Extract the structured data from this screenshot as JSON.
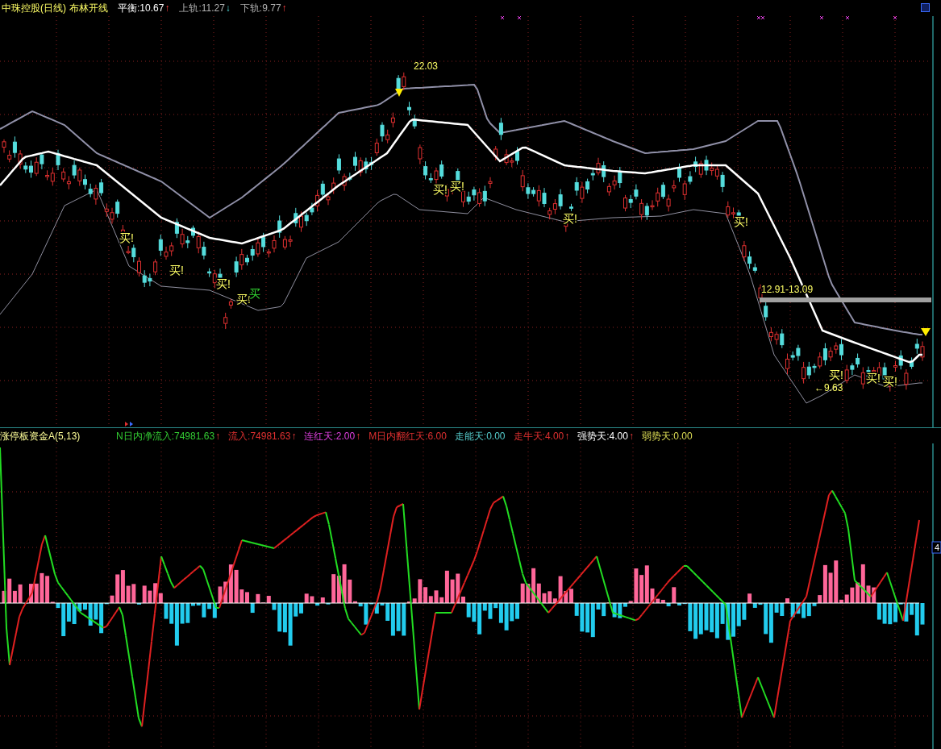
{
  "price_panel": {
    "title": "中珠控股(日线)",
    "indicator_name": "布林开线",
    "readings": [
      {
        "label": "平衡:10.67",
        "color": "#ffffff",
        "arrow": "↑"
      },
      {
        "label": "上轨:11.27",
        "color": "#b0b0b0",
        "arrow": "↓"
      },
      {
        "label": "下轨:9.77",
        "color": "#b0b0b0",
        "arrow": "↑"
      }
    ],
    "peak_label": "22.03",
    "range_label": "12.91-13.09",
    "low_label": "←9.63",
    "signals": [
      {
        "text": "买!",
        "kind": "buy"
      },
      {
        "text": "买!",
        "kind": "buy"
      },
      {
        "text": "买!",
        "kind": "buy"
      },
      {
        "text": "买!",
        "kind": "buy"
      },
      {
        "text": "买",
        "kind": "strong"
      },
      {
        "text": "买!",
        "kind": "buy"
      },
      {
        "text": "买!",
        "kind": "buy"
      },
      {
        "text": "买!",
        "kind": "buy"
      },
      {
        "text": "买!",
        "kind": "buy"
      },
      {
        "text": "买!",
        "kind": "buy"
      },
      {
        "text": "买!",
        "kind": "buy"
      },
      {
        "text": "买!",
        "kind": "buy"
      }
    ]
  },
  "indicator_panel": {
    "title": "涨停板资金A(5,13)",
    "readings": [
      {
        "label": "N日内净流入:74981.63",
        "color": "#33cc33",
        "arrow": "↑"
      },
      {
        "label": "流入:74981.63",
        "color": "#e03030",
        "arrow": "↑"
      },
      {
        "label": "连红天:2.00",
        "color": "#e040e0",
        "arrow": "↑"
      },
      {
        "label": "M日内翻红天:6.00",
        "color": "#e03030"
      },
      {
        "label": "走能天:0.00",
        "color": "#55cccc"
      },
      {
        "label": "走牛天:4.00",
        "color": "#e03030",
        "arrow": "↑"
      },
      {
        "label": "强势天:4.00",
        "color": "#ffffff",
        "arrow": "↑"
      },
      {
        "label": "弱势天:0.00",
        "color": "#dddd55"
      }
    ],
    "axis_label": "4"
  }
}
